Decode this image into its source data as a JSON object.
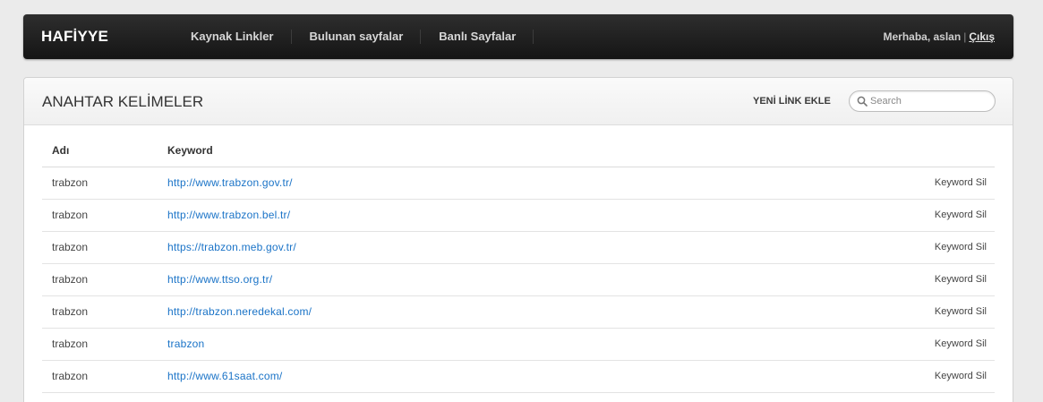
{
  "brand": "HAFİYYE",
  "nav": [
    "Kaynak Linkler",
    "Bulunan sayfalar",
    "Banlı Sayfalar"
  ],
  "user": {
    "greeting": "Merhaba, aslan",
    "separator": "|",
    "logout": "Çıkış"
  },
  "panel": {
    "title": "ANAHTAR KELİMELER",
    "add_link": "YENİ LİNK EKLE",
    "search_placeholder": "Search"
  },
  "table": {
    "headers": [
      "Adı",
      "Keyword",
      ""
    ],
    "action_label": "Keyword Sil",
    "rows": [
      {
        "name": "trabzon",
        "keyword": "http://www.trabzon.gov.tr/"
      },
      {
        "name": "trabzon",
        "keyword": "http://www.trabzon.bel.tr/"
      },
      {
        "name": "trabzon",
        "keyword": "https://trabzon.meb.gov.tr/"
      },
      {
        "name": "trabzon",
        "keyword": "http://www.ttso.org.tr/"
      },
      {
        "name": "trabzon",
        "keyword": "http://trabzon.neredekal.com/"
      },
      {
        "name": "trabzon",
        "keyword": "trabzon"
      },
      {
        "name": "trabzon",
        "keyword": "http://www.61saat.com/"
      }
    ]
  },
  "icons": {
    "search": "search-icon"
  },
  "colors": {
    "link": "#1a73c7",
    "topbar": "#1e1e1e"
  }
}
